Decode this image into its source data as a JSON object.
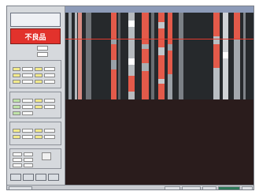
{
  "panel": {
    "title": "",
    "alarm_text": "不良品"
  },
  "params": [
    {
      "label": "",
      "value": ""
    },
    {
      "label": "",
      "value": ""
    }
  ],
  "colors": {
    "alarm_red": "#e2322c",
    "defect_red": "#e35a4a",
    "view_bg": "#26292c",
    "lower_bg": "#2a1c1c",
    "panel_bg": "#d6d9dd",
    "highlight_yellow": "#f2ea8c",
    "highlight_green": "#bfe3a8"
  },
  "icons": [
    "close-icon"
  ]
}
